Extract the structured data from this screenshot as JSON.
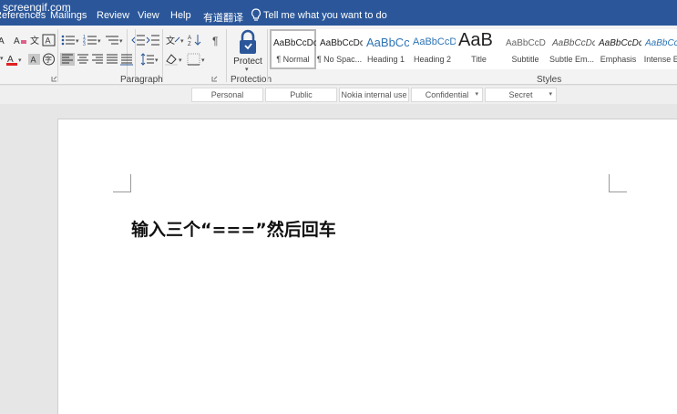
{
  "watermark": "screengif.com",
  "tabs": [
    "References",
    "Mailings",
    "Review",
    "View",
    "Help",
    "有道翻译"
  ],
  "tell_me": "Tell me what you want to do",
  "groups": {
    "paragraph": "Paragraph",
    "protection": "Protection",
    "styles": "Styles"
  },
  "protect_button": {
    "label": "Protect",
    "icon": "lock-icon"
  },
  "styles": [
    {
      "sample": "AaBbCcDc",
      "name": "¶ Normal",
      "selected": true
    },
    {
      "sample": "AaBbCcDc",
      "name": "¶ No Spac..."
    },
    {
      "sample": "AaBbCc",
      "name": "Heading 1"
    },
    {
      "sample": "AaBbCcD",
      "name": "Heading 2"
    },
    {
      "sample": "AaB",
      "name": "Title"
    },
    {
      "sample": "AaBbCcD",
      "name": "Subtitle"
    },
    {
      "sample": "AaBbCcDc",
      "name": "Subtle Em..."
    },
    {
      "sample": "AaBbCcDc",
      "name": "Emphasis"
    },
    {
      "sample": "AaBbCcDc",
      "name": "Intense E..."
    }
  ],
  "classification": [
    {
      "label": "Personal"
    },
    {
      "label": "Public"
    },
    {
      "label": "Nokia internal use"
    },
    {
      "label": "Confidential",
      "dropdown": true
    },
    {
      "label": "Secret",
      "dropdown": true
    }
  ],
  "document": {
    "text": "输入三个“===”然后回车"
  },
  "colors": {
    "ribbon_tab_bar": "#2b579a",
    "font_color_red": "#e02020",
    "highlight_yellow": "#ffff00",
    "heading_blue": "#2e74b5"
  }
}
